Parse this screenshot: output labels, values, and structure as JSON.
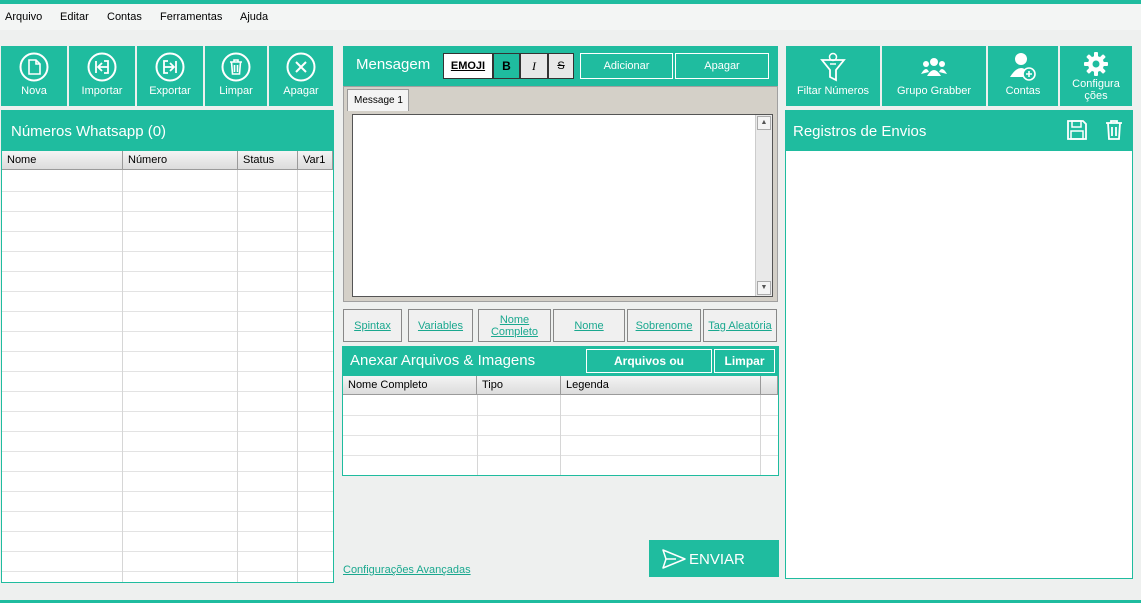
{
  "menu": [
    "Arquivo",
    "Editar",
    "Contas",
    "Ferramentas",
    "Ajuda"
  ],
  "toolbar_left": [
    {
      "label": "Nova",
      "icon": "new-file-icon"
    },
    {
      "label": "Importar",
      "icon": "import-icon"
    },
    {
      "label": "Exportar",
      "icon": "export-icon"
    },
    {
      "label": "Limpar",
      "icon": "trash-icon"
    },
    {
      "label": "Apagar",
      "icon": "close-circle-icon"
    }
  ],
  "numbers_panel": {
    "title": "Números Whatsapp (0)",
    "columns": [
      "Nome",
      "Número",
      "Status",
      "Var1"
    ]
  },
  "message": {
    "title": "Mensagem",
    "emoji": "EMOJI",
    "bold": "B",
    "italic": "I",
    "strike": "S",
    "add": "Adicionar",
    "delete": "Apagar",
    "tab": "Message 1",
    "text": ""
  },
  "insert_buttons": [
    "Spintax",
    "Variables",
    "Nome Completo",
    "Nome",
    "Sobrenome",
    "Tag Aleatória"
  ],
  "attach": {
    "title": "Anexar Arquivos & Imagens",
    "files_button": "Arquivos ou",
    "clear_button": "Limpar",
    "columns": [
      "Nome Completo",
      "Tipo",
      "Legenda"
    ]
  },
  "advanced_link": "Configurações Avançadas",
  "send_button": "ENVIAR",
  "toolbar_right": [
    {
      "label": "Filtar Números",
      "icon": "filter-icon"
    },
    {
      "label": "Grupo Grabber",
      "icon": "group-icon"
    },
    {
      "label": "Contas",
      "icon": "add-user-icon"
    },
    {
      "label": "Configura ções",
      "icon": "gear-icon"
    }
  ],
  "log_panel": {
    "title": "Registros de Envios"
  },
  "colors": {
    "accent": "#1fbc9f",
    "background": "#eef0ef"
  }
}
